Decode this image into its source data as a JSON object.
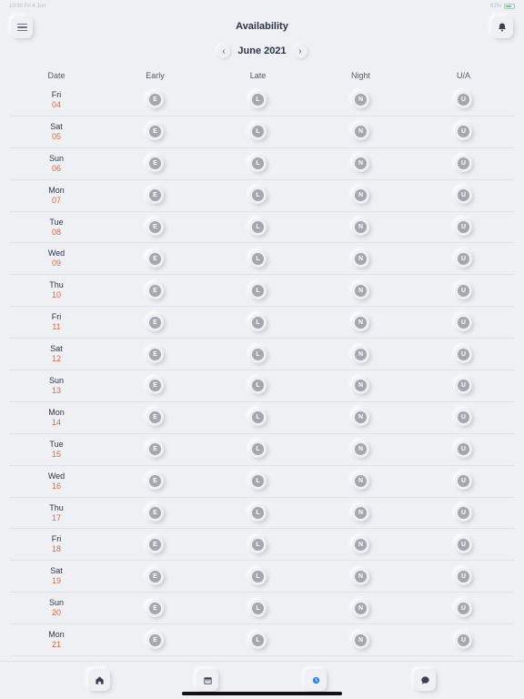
{
  "status": {
    "left": "10:30 Fri 4 Jun",
    "right": "61%"
  },
  "header": {
    "title": "Availability"
  },
  "month_nav": {
    "label": "June 2021",
    "prev": "‹",
    "next": "›"
  },
  "columns": [
    "Date",
    "Early",
    "Late",
    "Night",
    "U/A"
  ],
  "shift_letters": [
    "E",
    "L",
    "N",
    "U"
  ],
  "rows": [
    {
      "day": "Fri",
      "date": "04"
    },
    {
      "day": "Sat",
      "date": "05"
    },
    {
      "day": "Sun",
      "date": "06"
    },
    {
      "day": "Mon",
      "date": "07"
    },
    {
      "day": "Tue",
      "date": "08"
    },
    {
      "day": "Wed",
      "date": "09"
    },
    {
      "day": "Thu",
      "date": "10"
    },
    {
      "day": "Fri",
      "date": "11"
    },
    {
      "day": "Sat",
      "date": "12"
    },
    {
      "day": "Sun",
      "date": "13"
    },
    {
      "day": "Mon",
      "date": "14"
    },
    {
      "day": "Tue",
      "date": "15"
    },
    {
      "day": "Wed",
      "date": "16"
    },
    {
      "day": "Thu",
      "date": "17"
    },
    {
      "day": "Fri",
      "date": "18"
    },
    {
      "day": "Sat",
      "date": "19"
    },
    {
      "day": "Sun",
      "date": "20"
    },
    {
      "day": "Mon",
      "date": "21"
    }
  ],
  "tabs": [
    {
      "name": "home-icon",
      "active": false
    },
    {
      "name": "calendar-icon",
      "active": false
    },
    {
      "name": "availability-icon",
      "active": true
    },
    {
      "name": "chat-icon",
      "active": false
    }
  ],
  "colors": {
    "background": "#eef0f3",
    "date_number": "#e8643c",
    "shift_badge": "#a3a7ae",
    "active_tab": "#3b82f6"
  }
}
